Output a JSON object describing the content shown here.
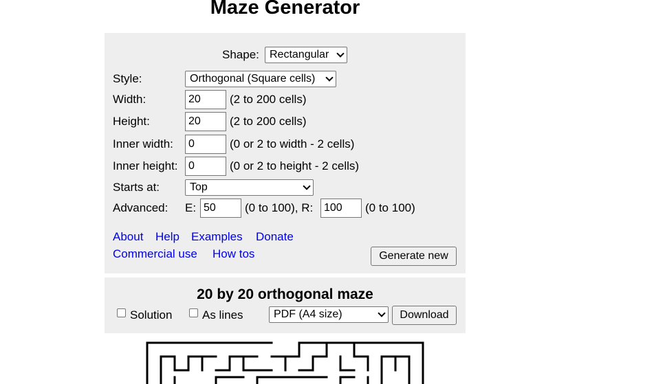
{
  "title": "Maze Generator",
  "settings": {
    "shape_label": "Shape:",
    "shape_value": "Rectangular",
    "style_label": "Style:",
    "style_value": "Orthogonal (Square cells)",
    "width_label": "Width:",
    "width_value": "20",
    "width_hint": "(2 to 200 cells)",
    "height_label": "Height:",
    "height_value": "20",
    "height_hint": "(2 to 200 cells)",
    "inner_width_label": "Inner width:",
    "inner_width_value": "0",
    "inner_width_hint": "(0 or 2 to width - 2 cells)",
    "inner_height_label": "Inner height:",
    "inner_height_value": "0",
    "inner_height_hint": "(0 or 2 to height - 2 cells)",
    "starts_label": "Starts at:",
    "starts_value": "Top",
    "advanced_label": "Advanced:",
    "e_label": "E:",
    "e_value": "50",
    "e_hint": "(0 to 100), R:",
    "r_value": "100",
    "r_hint": "(0 to 100)"
  },
  "links": {
    "about": "About",
    "help": "Help",
    "examples": "Examples",
    "donate": "Donate",
    "commercial": "Commercial use",
    "howtos": "How tos"
  },
  "generate_label": "Generate new",
  "result": {
    "title": "20 by 20 orthogonal maze",
    "solution_label": "Solution",
    "aslines_label": "As lines",
    "format_value": "PDF (A4 size)",
    "download_label": "Download"
  }
}
